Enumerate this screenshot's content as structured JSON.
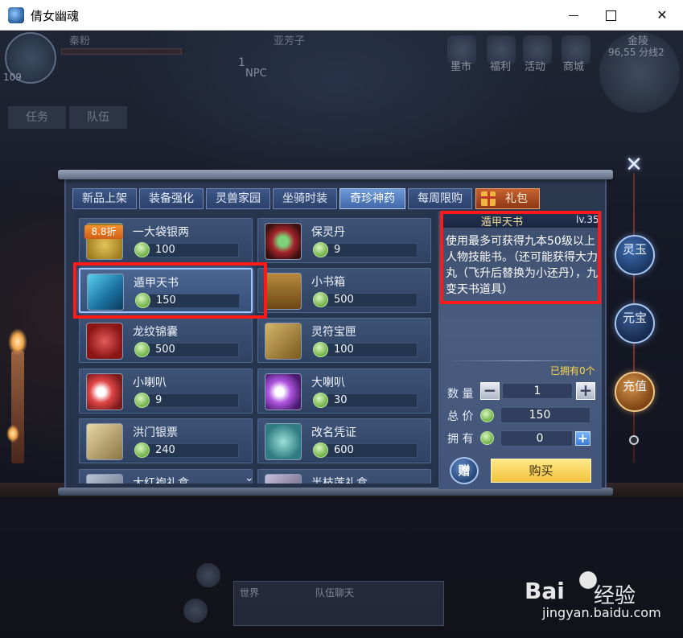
{
  "window": {
    "title": "倩女幽魂",
    "minimize": "—",
    "maximize": "☐",
    "close": "✕"
  },
  "hud": {
    "level": "109",
    "player_name": "秦粉",
    "target_name": "亚芳子",
    "npc_count": "1",
    "npc_label": "NPC",
    "map_name": "金陵",
    "coords": "96,55 分线2",
    "menu": [
      "墨市",
      "福利",
      "活动",
      "商城"
    ],
    "tabs": [
      "任务",
      "队伍"
    ]
  },
  "shop": {
    "tabs": [
      {
        "label": "新品上架",
        "active": false
      },
      {
        "label": "装备强化",
        "active": false
      },
      {
        "label": "灵兽家园",
        "active": false
      },
      {
        "label": "坐骑时装",
        "active": false
      },
      {
        "label": "奇珍神药",
        "active": true
      },
      {
        "label": "每周限购",
        "active": false
      }
    ],
    "gift_tab": "礼包",
    "items": [
      {
        "name": "一大袋银两",
        "price": "100",
        "icon": "silver-icon",
        "badge": "8.8折"
      },
      {
        "name": "保灵丹",
        "price": "9",
        "icon": "pill-icon"
      },
      {
        "name": "遁甲天书",
        "price": "150",
        "icon": "book-icon",
        "selected": true
      },
      {
        "name": "小书箱",
        "price": "500",
        "icon": "chest-icon"
      },
      {
        "name": "龙纹锦囊",
        "price": "500",
        "icon": "brocade-bag-icon"
      },
      {
        "name": "灵符宝匣",
        "price": "100",
        "icon": "talisman-box-icon"
      },
      {
        "name": "小喇叭",
        "price": "9",
        "icon": "small-horn-icon"
      },
      {
        "name": "大喇叭",
        "price": "30",
        "icon": "big-horn-icon"
      },
      {
        "name": "洪门银票",
        "price": "240",
        "icon": "ticket-icon"
      },
      {
        "name": "改名凭证",
        "price": "600",
        "icon": "rename-token-icon"
      },
      {
        "name": "大红袍礼盒",
        "price": "",
        "icon": "gift-box-icon"
      },
      {
        "name": "半枝莲礼盒",
        "price": "",
        "icon": "gift-box-icon"
      }
    ],
    "more_indicator": "⌄"
  },
  "detail": {
    "name": "遁甲天书",
    "level": "lv.35",
    "description": "使用最多可获得九本50级以上人物技能书。（还可能获得大力丸（飞升后替换为小还丹），九变天书道具）",
    "owned_note": "已拥有0个",
    "quantity_label": "数 量",
    "quantity": "1",
    "total_label": "总 价",
    "total": "150",
    "have_label": "拥 有",
    "have": "0",
    "minus": "−",
    "plus": "+",
    "gift_button": "赠",
    "buy_button": "购买"
  },
  "side": {
    "close": "✕",
    "lingyu": "灵玉",
    "yuanbao": "元宝",
    "chongzhi": "充值"
  },
  "bottom": {
    "chat1": "世界",
    "chat2": "队伍聊天"
  },
  "watermark": {
    "brand": "Bai",
    "brand2": "经验",
    "url": "jingyan.baidu.com"
  },
  "colors": {
    "annotation": "#ff1a1a",
    "buy": "#f2c33c",
    "badge": "#f39131"
  }
}
